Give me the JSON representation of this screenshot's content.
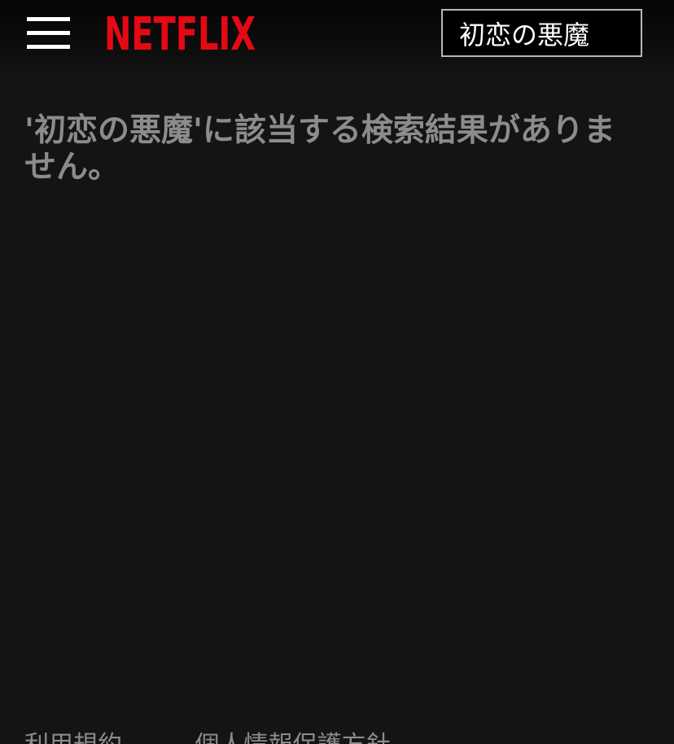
{
  "header": {
    "logo_text": "NETFLIX",
    "brand_color": "#E50914",
    "menu_icon": "hamburger-menu-icon",
    "search_value": "初恋の悪魔"
  },
  "main": {
    "no_results_message": "'初恋の悪魔'に該当する検索結果がありません。"
  },
  "footer": {
    "links": [
      "利用規約",
      "個人情報保護方針"
    ]
  }
}
